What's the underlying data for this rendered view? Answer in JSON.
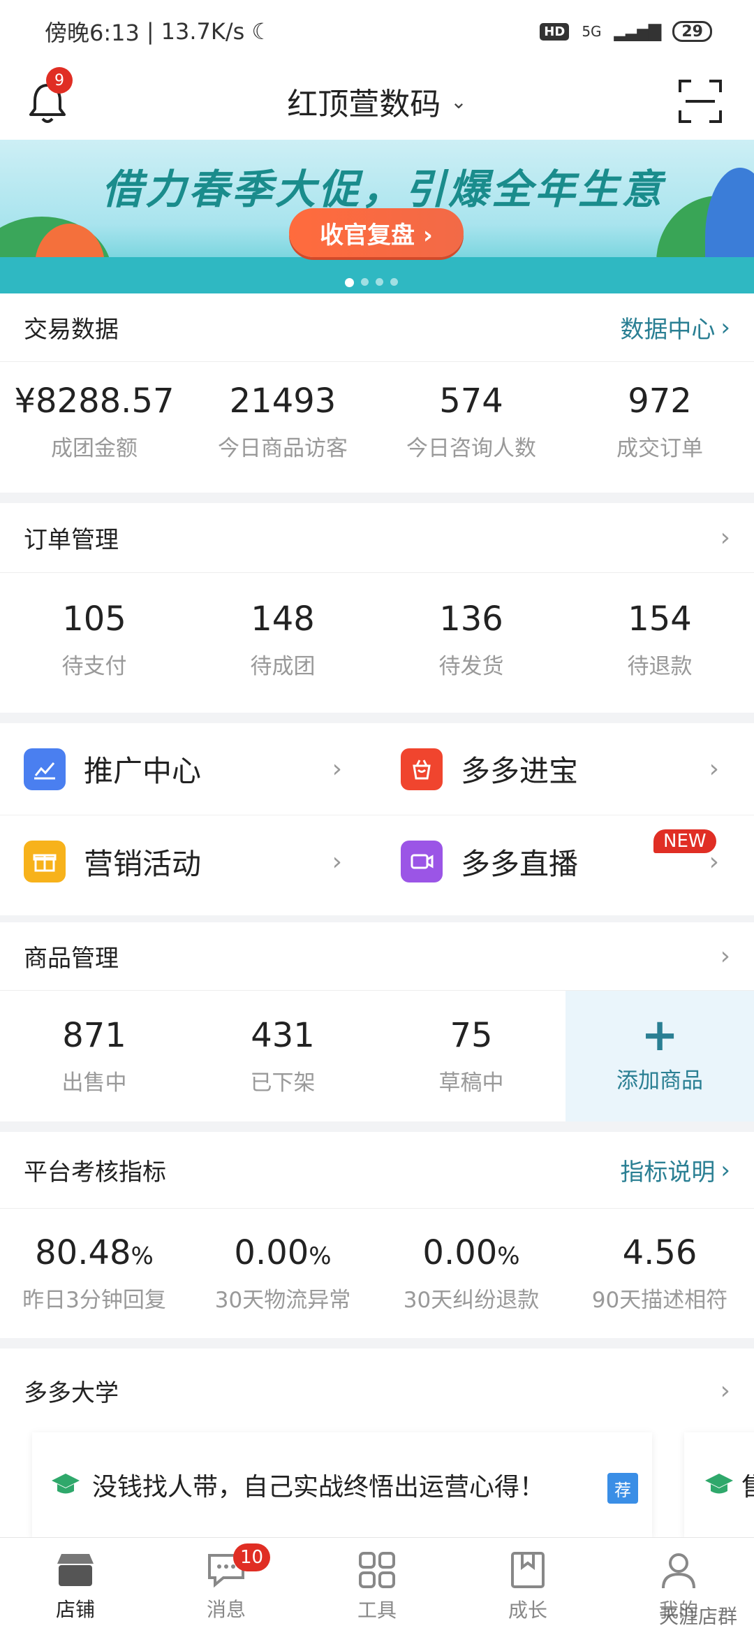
{
  "status_bar": {
    "time": "傍晚6:13",
    "speed": "13.7K/s",
    "network": "5G",
    "battery": "29"
  },
  "header": {
    "notification_count": "9",
    "shop_name": "红顶萱数码"
  },
  "banner": {
    "headline": "借力春季大促，引爆全年生意",
    "button": "收官复盘 ›"
  },
  "trade": {
    "title": "交易数据",
    "link": "数据中心",
    "stats": [
      {
        "value": "¥8288.57",
        "label": "成团金额"
      },
      {
        "value": "21493",
        "label": "今日商品访客"
      },
      {
        "value": "574",
        "label": "今日咨询人数"
      },
      {
        "value": "972",
        "label": "成交订单"
      }
    ]
  },
  "orders": {
    "title": "订单管理",
    "stats": [
      {
        "value": "105",
        "label": "待支付"
      },
      {
        "value": "148",
        "label": "待成团"
      },
      {
        "value": "136",
        "label": "待发货"
      },
      {
        "value": "154",
        "label": "待退款"
      }
    ]
  },
  "menu": {
    "promote": "推广中心",
    "duoduo_bao": "多多进宝",
    "marketing": "营销活动",
    "live": "多多直播",
    "new_badge": "NEW"
  },
  "products": {
    "title": "商品管理",
    "stats": [
      {
        "value": "871",
        "label": "出售中"
      },
      {
        "value": "431",
        "label": "已下架"
      },
      {
        "value": "75",
        "label": "草稿中"
      }
    ],
    "add_label": "添加商品"
  },
  "metrics": {
    "title": "平台考核指标",
    "link": "指标说明",
    "stats": [
      {
        "value": "80.48",
        "unit": "%",
        "label": "昨日3分钟回复"
      },
      {
        "value": "0.00",
        "unit": "%",
        "label": "30天物流异常"
      },
      {
        "value": "0.00",
        "unit": "%",
        "label": "30天纠纷退款"
      },
      {
        "value": "4.56",
        "unit": "",
        "label": "90天描述相符"
      }
    ]
  },
  "university": {
    "title": "多多大学",
    "course": "没钱找人带，自己实战终悟出运营心得！",
    "tag": "荐",
    "course2_initial": "售"
  },
  "tabs": {
    "shop": "店铺",
    "messages": "消息",
    "messages_badge": "10",
    "tools": "工具",
    "growth": "成长",
    "mine": "我的"
  },
  "watermark": "天涯店群",
  "colors": {
    "accent": "#2a7f93",
    "badge": "#e02e24",
    "add_bg": "#eaf5fb"
  }
}
